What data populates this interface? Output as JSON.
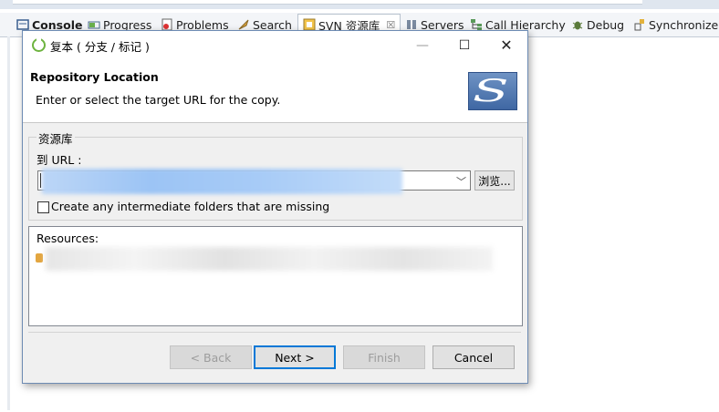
{
  "views": {
    "tabs": [
      {
        "label": "Console",
        "icon": "console-icon"
      },
      {
        "label": "Progress",
        "icon": "progress-icon"
      },
      {
        "label": "Problems",
        "icon": "problems-icon"
      },
      {
        "label": "Search",
        "icon": "search-icon"
      },
      {
        "label": "SVN 资源库",
        "icon": "svn-repository-icon"
      },
      {
        "label": "Servers",
        "icon": "servers-icon"
      },
      {
        "label": "Call Hierarchy",
        "icon": "call-hierarchy-icon"
      },
      {
        "label": "Debug",
        "icon": "debug-icon"
      },
      {
        "label": "Synchronize",
        "icon": "synchronize-icon"
      }
    ],
    "active_close": "☒"
  },
  "dialog": {
    "title": "复本 ( 分支 / 标记 )",
    "header_title": "Repository Location",
    "header_desc": "Enter or select the target URL for the copy.",
    "logo_letter": "S",
    "group_label": "资源库",
    "url_label": "到 URL :",
    "browse_label": "浏览...",
    "checkbox_label": "Create any intermediate folders that are missing",
    "checkbox_checked": false,
    "resources_label": "Resources:",
    "buttons": {
      "back": "< Back",
      "next": "Next >",
      "finish": "Finish",
      "cancel": "Cancel"
    }
  },
  "colors": {
    "accent": "#0078d7",
    "spring_green": "#6db33f",
    "svn_logo": "#4a72ad"
  }
}
